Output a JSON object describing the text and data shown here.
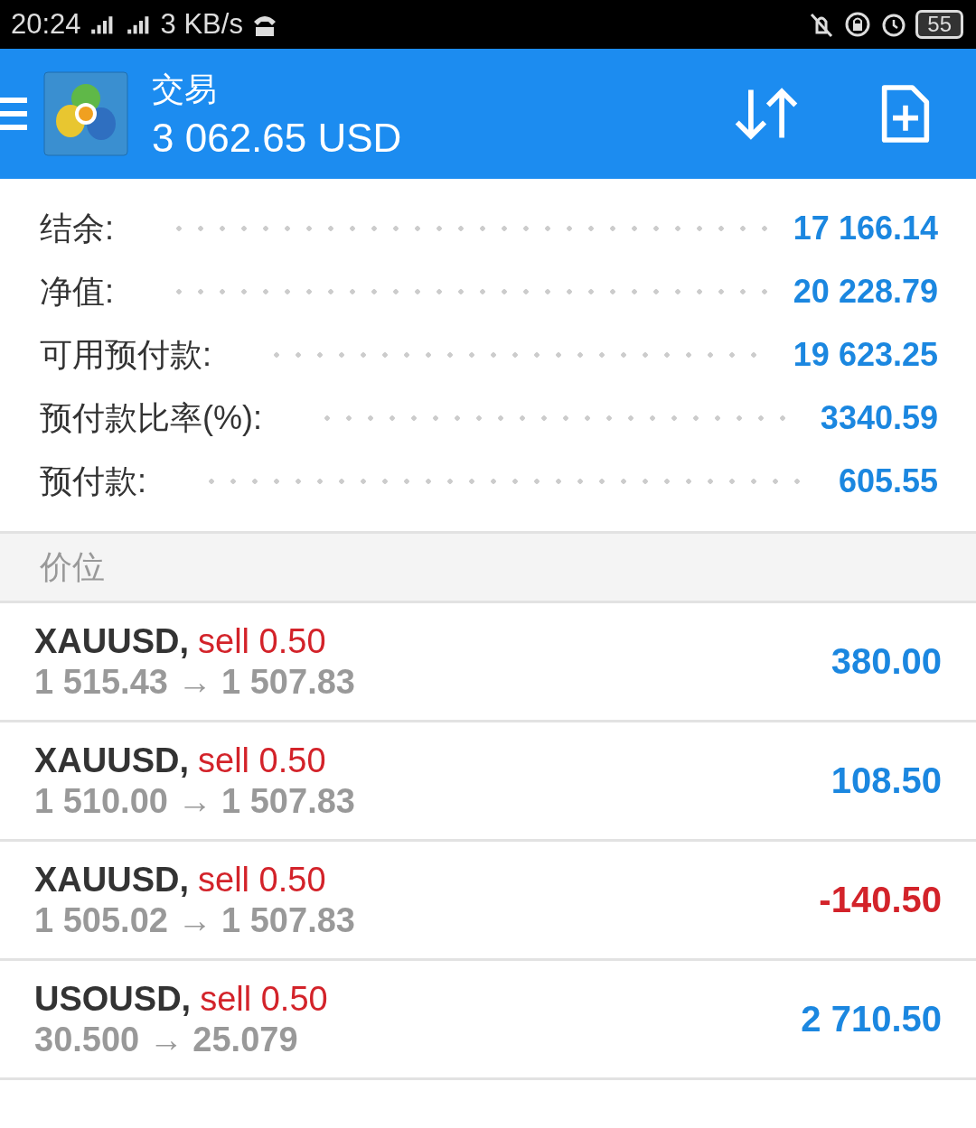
{
  "status_bar": {
    "time": "20:24",
    "net_speed": "3 KB/s",
    "battery": "55"
  },
  "header": {
    "title": "交易",
    "balance": "3 062.65 USD"
  },
  "summary": [
    {
      "label": "结余:",
      "value": "17 166.14"
    },
    {
      "label": "净值:",
      "value": "20 228.79"
    },
    {
      "label": "可用预付款:",
      "value": "19 623.25"
    },
    {
      "label": "预付款比率(%):",
      "value": "3340.59"
    },
    {
      "label": "预付款:",
      "value": "605.55"
    }
  ],
  "section": {
    "title": "价位"
  },
  "positions": [
    {
      "symbol": "XAUUSD,",
      "order": "sell 0.50",
      "prices": "1 515.43 → 1 507.83",
      "profit": "380.00",
      "color": "#1b87e0"
    },
    {
      "symbol": "XAUUSD,",
      "order": "sell 0.50",
      "prices": "1 510.00 → 1 507.83",
      "profit": "108.50",
      "color": "#1b87e0"
    },
    {
      "symbol": "XAUUSD,",
      "order": "sell 0.50",
      "prices": "1 505.02 → 1 507.83",
      "profit": "-140.50",
      "color": "#d3232a"
    },
    {
      "symbol": "USOUSD,",
      "order": "sell 0.50",
      "prices": "30.500 → 25.079",
      "profit": "2 710.50",
      "color": "#1b87e0"
    }
  ]
}
